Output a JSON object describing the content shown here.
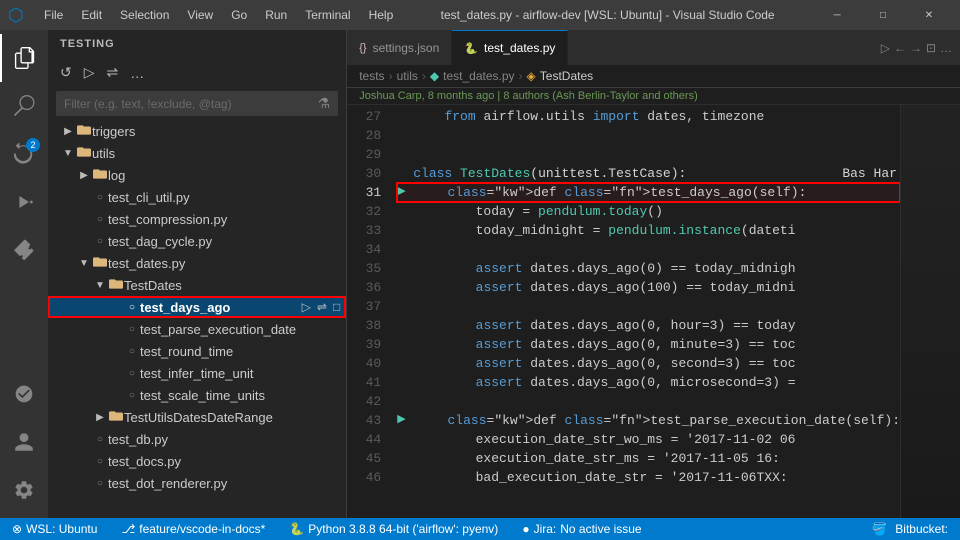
{
  "menubar": {
    "appIcon": "▶",
    "menus": [
      "File",
      "Edit",
      "Selection",
      "View",
      "Go",
      "Run",
      "Terminal",
      "Help"
    ],
    "title": "test_dates.py - airflow-dev [WSL: Ubuntu] - Visual Studio Code",
    "windowBtns": [
      "─",
      "□",
      "✕"
    ]
  },
  "activitybar": {
    "icons": [
      {
        "name": "explorer-icon",
        "glyph": "⎘",
        "active": true
      },
      {
        "name": "search-icon",
        "glyph": "🔍",
        "active": false
      },
      {
        "name": "source-control-icon",
        "glyph": "⎇",
        "active": false,
        "badge": "2"
      },
      {
        "name": "run-icon",
        "glyph": "▷",
        "active": false
      },
      {
        "name": "extensions-icon",
        "glyph": "⊞",
        "active": false
      }
    ],
    "bottomIcons": [
      {
        "name": "remote-icon",
        "glyph": "⊗"
      },
      {
        "name": "accounts-icon",
        "glyph": "👤"
      },
      {
        "name": "settings-icon",
        "glyph": "⚙"
      }
    ]
  },
  "sidebar": {
    "header": "TESTING",
    "toolbarBtns": [
      "↺",
      "▷",
      "⇌",
      "…"
    ],
    "searchPlaceholder": "Filter (e.g. text, !exclude, @tag)",
    "tree": [
      {
        "id": "triggers",
        "label": "triggers",
        "indent": 1,
        "arrow": "▶",
        "icon": "",
        "type": "folder"
      },
      {
        "id": "utils",
        "label": "utils",
        "indent": 1,
        "arrow": "▼",
        "icon": "",
        "type": "folder"
      },
      {
        "id": "log",
        "label": "log",
        "indent": 2,
        "arrow": "▶",
        "icon": "",
        "type": "folder"
      },
      {
        "id": "test_cli_util",
        "label": "test_cli_util.py",
        "indent": 2,
        "arrow": "",
        "icon": "○",
        "type": "file"
      },
      {
        "id": "test_compression",
        "label": "test_compression.py",
        "indent": 2,
        "arrow": "",
        "icon": "○",
        "type": "file"
      },
      {
        "id": "test_dag_cycle",
        "label": "test_dag_cycle.py",
        "indent": 2,
        "arrow": "",
        "icon": "○",
        "type": "file"
      },
      {
        "id": "test_dates",
        "label": "test_dates.py",
        "indent": 2,
        "arrow": "▼",
        "icon": "",
        "type": "folder"
      },
      {
        "id": "TestDates",
        "label": "TestDates",
        "indent": 3,
        "arrow": "▼",
        "icon": "",
        "type": "folder"
      },
      {
        "id": "test_days_ago",
        "label": "test_days_ago",
        "indent": 4,
        "arrow": "",
        "icon": "○",
        "type": "item",
        "selected": true,
        "actions": [
          "▷",
          "⇌",
          "□"
        ]
      },
      {
        "id": "test_parse_execution_date",
        "label": "test_parse_execution_date",
        "indent": 4,
        "arrow": "",
        "icon": "○",
        "type": "item"
      },
      {
        "id": "test_round_time",
        "label": "test_round_time",
        "indent": 4,
        "arrow": "",
        "icon": "○",
        "type": "item"
      },
      {
        "id": "test_infer_time_unit",
        "label": "test_infer_time_unit",
        "indent": 4,
        "arrow": "",
        "icon": "○",
        "type": "item"
      },
      {
        "id": "test_scale_time_units",
        "label": "test_scale_time_units",
        "indent": 4,
        "arrow": "",
        "icon": "○",
        "type": "item"
      },
      {
        "id": "TestUtilsDatesDateRange",
        "label": "TestUtilsDatesDateRange",
        "indent": 3,
        "arrow": "▶",
        "icon": "",
        "type": "folder"
      },
      {
        "id": "test_db",
        "label": "test_db.py",
        "indent": 2,
        "arrow": "",
        "icon": "○",
        "type": "file"
      },
      {
        "id": "test_docs",
        "label": "test_docs.py",
        "indent": 2,
        "arrow": "",
        "icon": "○",
        "type": "file"
      },
      {
        "id": "test_dot_renderer",
        "label": "test_dot_renderer.py",
        "indent": 2,
        "arrow": "",
        "icon": "○",
        "type": "file"
      }
    ]
  },
  "tabs": [
    {
      "label": "settings.json",
      "icon": "{}",
      "active": false,
      "modified": false
    },
    {
      "label": "test_dates.py",
      "icon": "🐍",
      "active": true,
      "modified": false
    }
  ],
  "breadcrumb": [
    "tests",
    "utils",
    "test_dates.py",
    "TestDates"
  ],
  "blame": "Joshua Carp, 8 months ago | 8 authors (Ash Berlin-Taylor and others)",
  "lines": [
    {
      "num": 27,
      "content": "    from airflow.utils import dates, timezone",
      "runBtn": false
    },
    {
      "num": 28,
      "content": "",
      "runBtn": false
    },
    {
      "num": 29,
      "content": "",
      "runBtn": false
    },
    {
      "num": 30,
      "content": "class TestDates(unittest.TestCase):                    Bas Har",
      "runBtn": false,
      "cls": true
    },
    {
      "num": 31,
      "content": "    def test_days_ago(self):",
      "runBtn": true,
      "highlighted": true
    },
    {
      "num": 32,
      "content": "        today = pendulum.today()",
      "runBtn": false
    },
    {
      "num": 33,
      "content": "        today_midnight = pendulum.instance(dateti",
      "runBtn": false
    },
    {
      "num": 34,
      "content": "",
      "runBtn": false
    },
    {
      "num": 35,
      "content": "        assert dates.days_ago(0) == today_midnigh",
      "runBtn": false
    },
    {
      "num": 36,
      "content": "        assert dates.days_ago(100) == today_midni",
      "runBtn": false
    },
    {
      "num": 37,
      "content": "",
      "runBtn": false
    },
    {
      "num": 38,
      "content": "        assert dates.days_ago(0, hour=3) == today",
      "runBtn": false
    },
    {
      "num": 39,
      "content": "        assert dates.days_ago(0, minute=3) == toc",
      "runBtn": false
    },
    {
      "num": 40,
      "content": "        assert dates.days_ago(0, second=3) == toc",
      "runBtn": false
    },
    {
      "num": 41,
      "content": "        assert dates.days_ago(0, microsecond=3) =",
      "runBtn": false
    },
    {
      "num": 42,
      "content": "",
      "runBtn": false
    },
    {
      "num": 43,
      "content": "    def test_parse_execution_date(self):",
      "runBtn": true
    },
    {
      "num": 44,
      "content": "        execution_date_str_wo_ms = '2017-11-02 06",
      "runBtn": false
    },
    {
      "num": 45,
      "content": "        execution_date_str_ms = '2017-11-05 16:",
      "runBtn": false
    },
    {
      "num": 46,
      "content": "        bad_execution_date_str = '2017-11-06TXX:",
      "runBtn": false
    }
  ],
  "statusbar": {
    "remote": "WSL: Ubuntu",
    "branch": "feature/vscode-in-docs*",
    "python": "Python 3.8.8 64-bit ('airflow': pyenv)",
    "jira": "Jira:",
    "noIssue": "No active issue",
    "bitbucket": "Bitbucket:"
  }
}
